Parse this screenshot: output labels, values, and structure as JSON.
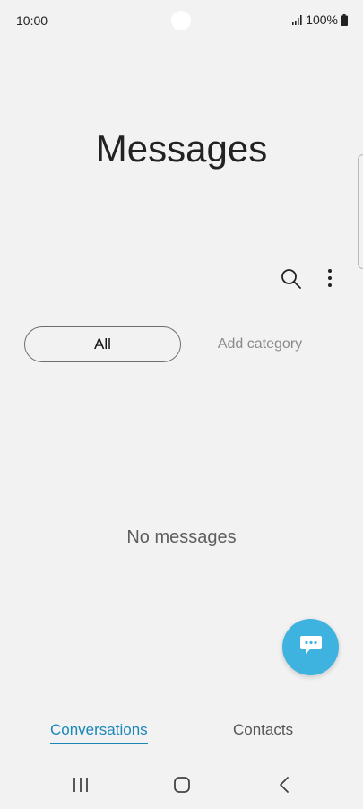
{
  "status_bar": {
    "time": "10:00",
    "battery": "100%"
  },
  "header": {
    "title": "Messages"
  },
  "toolbar": {
    "search_icon": "search-icon",
    "more_icon": "more-vert-icon"
  },
  "categories": {
    "all_label": "All",
    "add_label": "Add category"
  },
  "main": {
    "empty_text": "No messages"
  },
  "fab": {
    "icon": "chat-bubble-icon",
    "color": "#3fb3e0"
  },
  "bottom_tabs": {
    "conversations": "Conversations",
    "contacts": "Contacts",
    "active_color": "#1b87b7"
  },
  "nav_bar": {
    "recents_icon": "recents-icon",
    "home_icon": "home-icon",
    "back_icon": "back-icon"
  }
}
